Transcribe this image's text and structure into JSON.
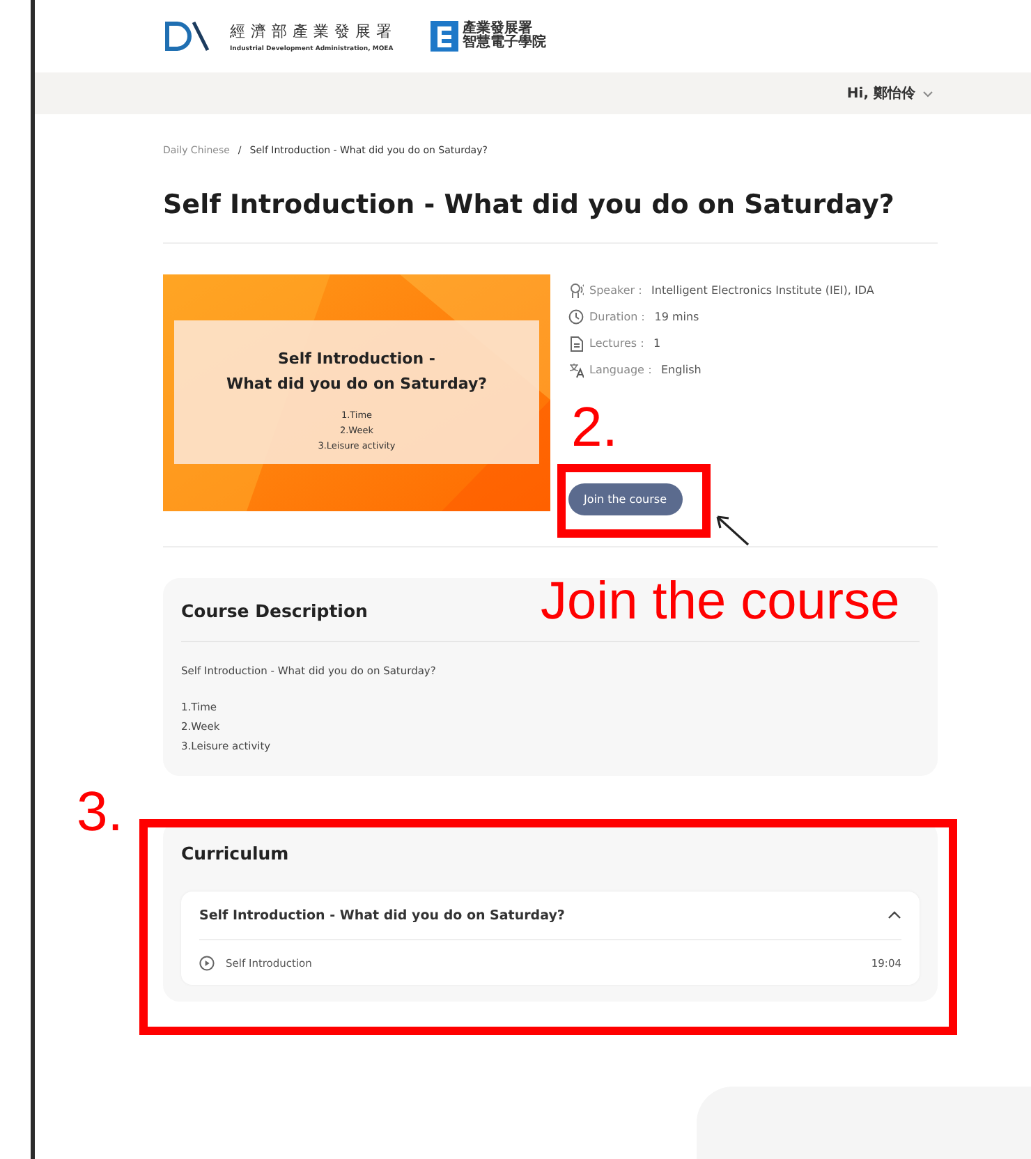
{
  "header": {
    "logo_title": "經濟部產業發展署",
    "logo_subtitle": "Industrial Development Administration, MOEA",
    "partner_line1": "產業發展署",
    "partner_line2": "智慧電子學院"
  },
  "user_menu": {
    "greeting": "Hi, 鄭怡伶"
  },
  "breadcrumb": [
    {
      "label": "Daily Chinese"
    },
    {
      "label": "Self Introduction - What did you do on Saturday?"
    }
  ],
  "breadcrumb_separator": "/",
  "title": "Self Introduction - What did you do on Saturday?",
  "thumbnail": {
    "title_line1": "Self Introduction -",
    "title_line2": "What did you do on Saturday?",
    "items": [
      "1.Time",
      "2.Week",
      "3.Leisure activity"
    ]
  },
  "meta": [
    {
      "kind": "speaker",
      "label": "Speaker：",
      "value": "Intelligent Electronics Institute (IEI), IDA"
    },
    {
      "kind": "duration",
      "label": "Duration：",
      "value": "19 mins"
    },
    {
      "kind": "lectures",
      "label": "Lectures：",
      "value": "1"
    },
    {
      "kind": "language",
      "label": "Language：",
      "value": "English"
    }
  ],
  "join_button": "Join the course",
  "description": {
    "heading": "Course Description",
    "text": "Self Introduction - What did you do on Saturday?",
    "items": [
      "1.Time",
      "2.Week",
      "3.Leisure activity"
    ]
  },
  "curriculum": {
    "heading": "Curriculum",
    "sections": [
      {
        "title": "Self Introduction - What did you do on Saturday?",
        "expanded": true,
        "lessons": [
          {
            "title": "Self Introduction",
            "duration": "19:04"
          }
        ]
      }
    ]
  },
  "annotations": [
    {
      "kind": "step",
      "text": "2."
    },
    {
      "kind": "callout",
      "text": "Join the course"
    },
    {
      "kind": "step",
      "text": "3."
    }
  ]
}
